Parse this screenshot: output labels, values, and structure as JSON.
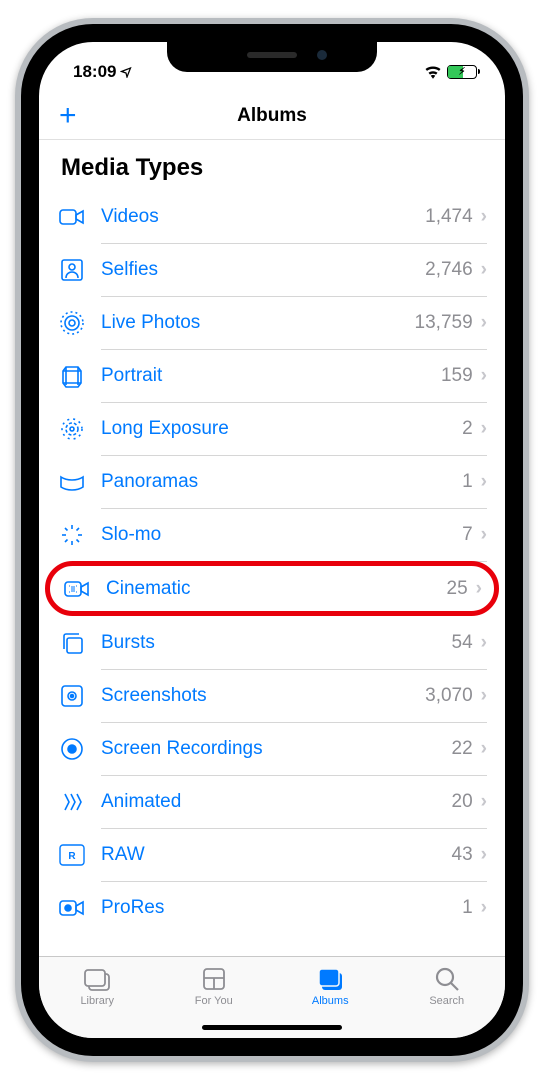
{
  "status": {
    "time": "18:09"
  },
  "nav": {
    "title": "Albums"
  },
  "section": {
    "title": "Media Types"
  },
  "rows": [
    {
      "icon": "video",
      "label": "Videos",
      "count": "1,474"
    },
    {
      "icon": "selfie",
      "label": "Selfies",
      "count": "2,746"
    },
    {
      "icon": "live",
      "label": "Live Photos",
      "count": "13,759"
    },
    {
      "icon": "portrait",
      "label": "Portrait",
      "count": "159"
    },
    {
      "icon": "longexp",
      "label": "Long Exposure",
      "count": "2"
    },
    {
      "icon": "pano",
      "label": "Panoramas",
      "count": "1"
    },
    {
      "icon": "slomo",
      "label": "Slo-mo",
      "count": "7"
    },
    {
      "icon": "cinematic",
      "label": "Cinematic",
      "count": "25",
      "highlighted": true
    },
    {
      "icon": "bursts",
      "label": "Bursts",
      "count": "54"
    },
    {
      "icon": "screenshots",
      "label": "Screenshots",
      "count": "3,070"
    },
    {
      "icon": "screenrec",
      "label": "Screen Recordings",
      "count": "22"
    },
    {
      "icon": "animated",
      "label": "Animated",
      "count": "20"
    },
    {
      "icon": "raw",
      "label": "RAW",
      "count": "43"
    },
    {
      "icon": "prores",
      "label": "ProRes",
      "count": "1"
    }
  ],
  "tabs": [
    {
      "id": "library",
      "label": "Library"
    },
    {
      "id": "foryou",
      "label": "For You"
    },
    {
      "id": "albums",
      "label": "Albums",
      "active": true
    },
    {
      "id": "search",
      "label": "Search"
    }
  ]
}
